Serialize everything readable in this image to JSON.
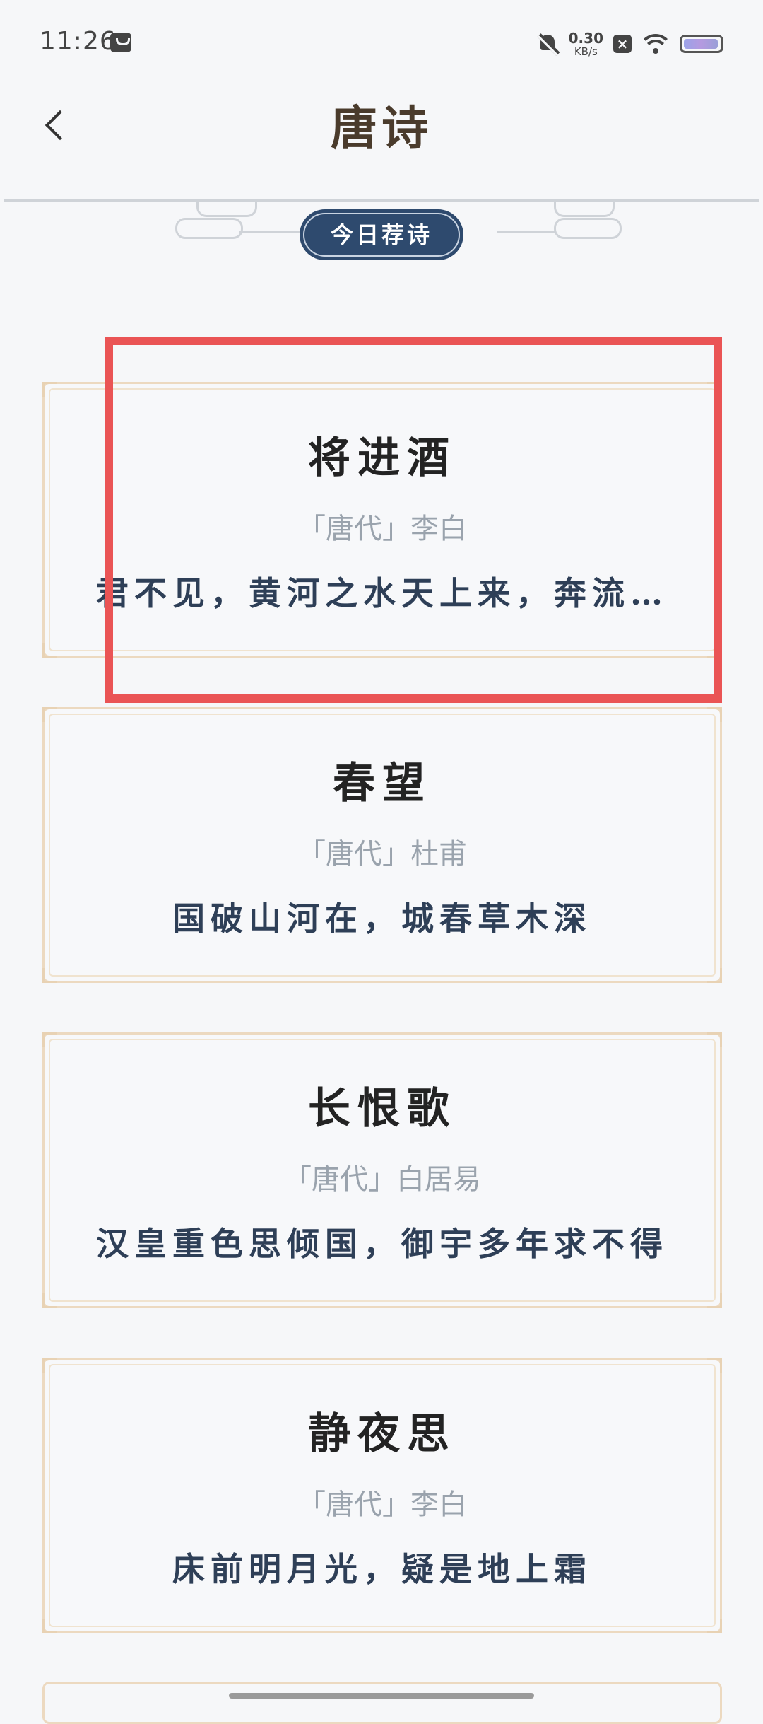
{
  "status_bar": {
    "time": "11:26",
    "net_speed_value": "0.30",
    "net_speed_unit": "KB/s",
    "x_glyph": "×"
  },
  "header": {
    "title": "唐诗",
    "back_icon": "chevron-left-icon"
  },
  "banner": {
    "label": "今日荐诗"
  },
  "poems": [
    {
      "title": "将进酒",
      "meta": "「唐代」李白",
      "line": "君不见，黄河之水天上来，奔流…"
    },
    {
      "title": "春望",
      "meta": "「唐代」杜甫",
      "line": "国破山河在，城春草木深"
    },
    {
      "title": "长恨歌",
      "meta": "「唐代」白居易",
      "line": "汉皇重色思倾国，御宇多年求不得"
    },
    {
      "title": "静夜思",
      "meta": "「唐代」李白",
      "line": "床前明月光，疑是地上霜"
    }
  ],
  "colors": {
    "badge_bg": "#2e4a6e",
    "card_border": "#ecd9c0",
    "highlight": "#ea5455",
    "verse_text": "#2e3f57"
  }
}
